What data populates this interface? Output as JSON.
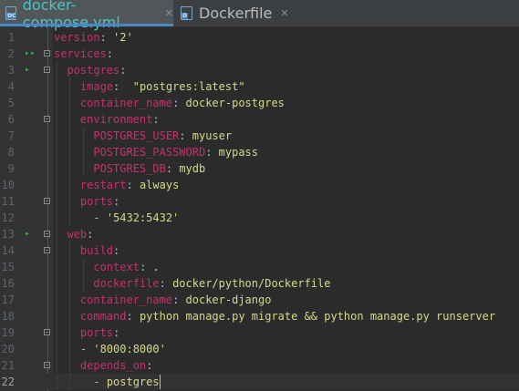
{
  "tabs": [
    {
      "label": "docker-compose.yml",
      "icon": "yaml-file-icon",
      "badge": "DC",
      "active": true
    },
    {
      "label": "Dockerfile",
      "icon": "dockerfile-icon",
      "badge": "D",
      "active": false
    }
  ],
  "tab_close_glyph": "✕",
  "run_glyph_double": "▸▸",
  "run_glyph": "▸",
  "colors": {
    "background": "#2b2b2b",
    "key": "#c6306f",
    "string": "#d7d98b",
    "value": "#a9b7c6",
    "line_number": "#606366",
    "run_marker": "#499c54"
  },
  "lines": [
    {
      "n": "1",
      "key": "version",
      "val": "'2'",
      "valtype": "s"
    },
    {
      "n": "2",
      "key": "services",
      "val": "",
      "valtype": "v"
    },
    {
      "n": "3",
      "key": "postgres",
      "val": "",
      "valtype": "v"
    },
    {
      "n": "4",
      "key": "image",
      "val": " \"postgres:latest\"",
      "valtype": "s"
    },
    {
      "n": "5",
      "key": "container_name",
      "val": "docker-postgres",
      "valtype": "s"
    },
    {
      "n": "6",
      "key": "environment",
      "val": "",
      "valtype": "v"
    },
    {
      "n": "7",
      "key": "POSTGRES_USER",
      "val": "myuser",
      "valtype": "s"
    },
    {
      "n": "8",
      "key": "POSTGRES_PASSWORD",
      "val": "mypass",
      "valtype": "s"
    },
    {
      "n": "9",
      "key": "POSTGRES_DB",
      "val": "mydb",
      "valtype": "s"
    },
    {
      "n": "10",
      "key": "restart",
      "val": "always",
      "valtype": "s"
    },
    {
      "n": "11",
      "key": "ports",
      "val": "",
      "valtype": "v"
    },
    {
      "n": "12",
      "key": "",
      "val": "'5432:5432'",
      "valtype": "s"
    },
    {
      "n": "13",
      "key": "web",
      "val": "",
      "valtype": "v"
    },
    {
      "n": "14",
      "key": "build",
      "val": "",
      "valtype": "v"
    },
    {
      "n": "15",
      "key": "context",
      "val": ".",
      "valtype": "s"
    },
    {
      "n": "16",
      "key": "dockerfile",
      "val": "docker/python/Dockerfile",
      "valtype": "s"
    },
    {
      "n": "17",
      "key": "container_name",
      "val": "docker-django",
      "valtype": "s"
    },
    {
      "n": "18",
      "key": "command",
      "val": "python manage.py migrate && python manage.py runserver",
      "valtype": "s"
    },
    {
      "n": "19",
      "key": "ports",
      "val": "",
      "valtype": "v"
    },
    {
      "n": "20",
      "key": "",
      "val": "'8000:8000'",
      "valtype": "s"
    },
    {
      "n": "21",
      "key": "depends_on",
      "val": "",
      "valtype": "v"
    },
    {
      "n": "22",
      "key": "",
      "val": "postgres",
      "valtype": "s"
    }
  ]
}
